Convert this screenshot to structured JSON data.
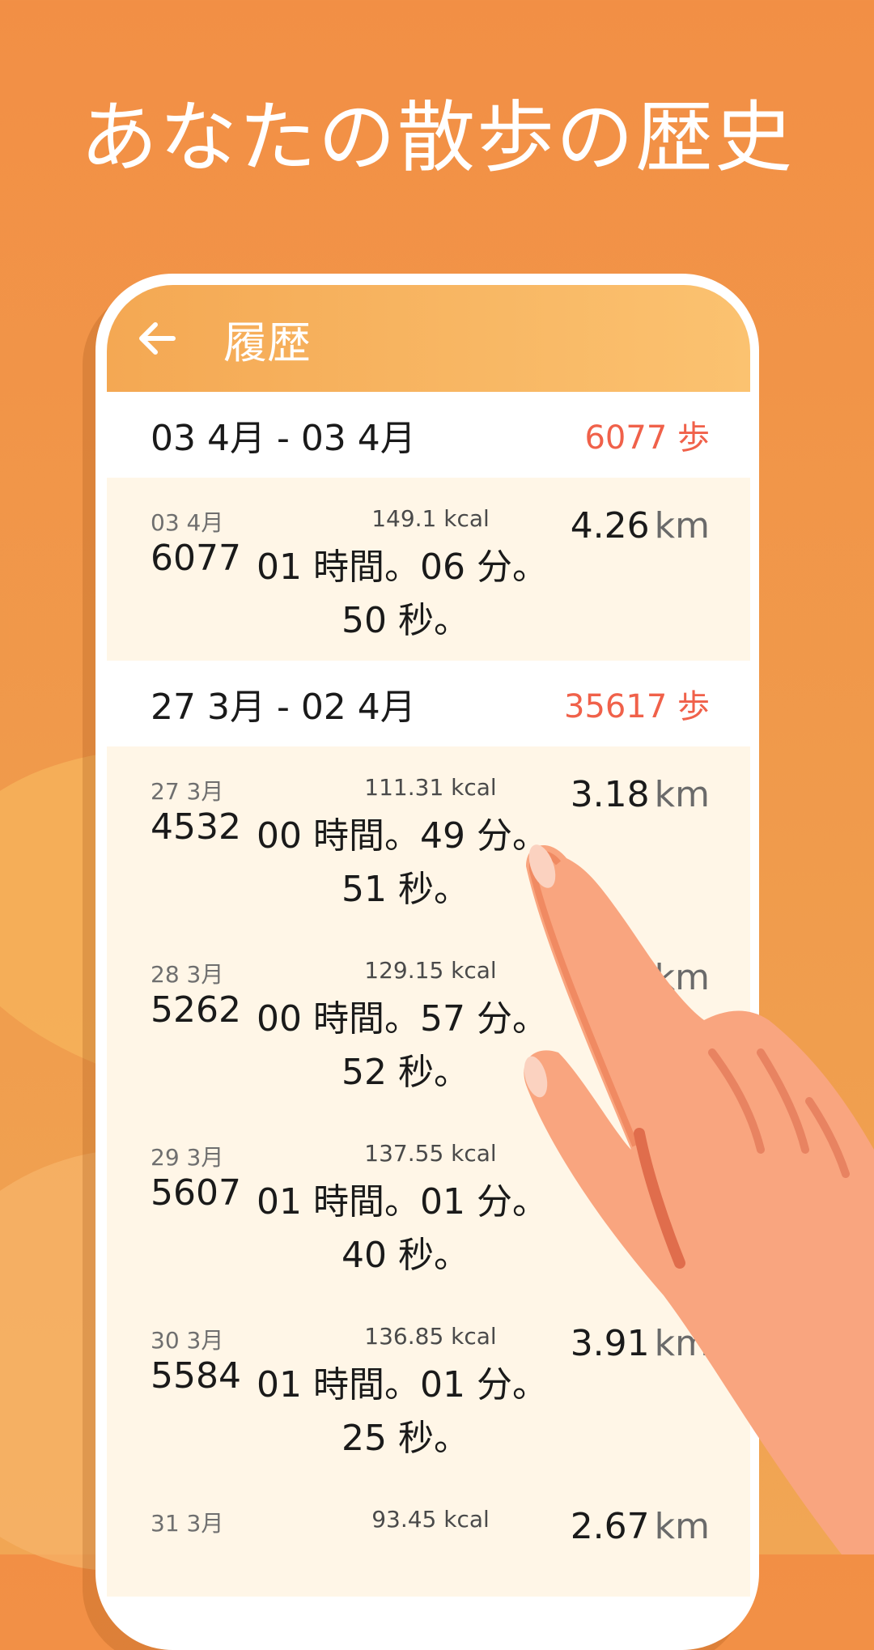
{
  "headline": "あなたの散歩の歴史",
  "appbar": {
    "title": "履歴"
  },
  "weeks": [
    {
      "range": "03 4月 - 03 4月",
      "steps": "6077 歩",
      "days": [
        {
          "date": "03 4月",
          "kcal": "149.1 kcal",
          "steps": "6077",
          "time_hm": "01 時間。06 分。",
          "time_s": "50 秒。",
          "distance": "4.26",
          "unit": "km"
        }
      ]
    },
    {
      "range": "27 3月 - 02 4月",
      "steps": "35617 歩",
      "days": [
        {
          "date": "27 3月",
          "kcal": "111.31 kcal",
          "steps": "4532",
          "time_hm": "00 時間。49 分。",
          "time_s": "51 秒。",
          "distance": "3.18",
          "unit": "km"
        },
        {
          "date": "28 3月",
          "kcal": "129.15 kcal",
          "steps": "5262",
          "time_hm": "00 時間。57 分。",
          "time_s": "52 秒。",
          "distance": "3.",
          "unit": "km"
        },
        {
          "date": "29 3月",
          "kcal": "137.55 kcal",
          "steps": "5607",
          "time_hm": "01 時間。01 分。",
          "time_s": "40 秒。",
          "distance": "",
          "unit": ""
        },
        {
          "date": "30 3月",
          "kcal": "136.85 kcal",
          "steps": "5584",
          "time_hm": "01 時間。01 分。",
          "time_s": "25 秒。",
          "distance": "3.91",
          "unit": "km"
        },
        {
          "date": "31 3月",
          "kcal": "93.45 kcal",
          "steps": "",
          "time_hm": "",
          "time_s": "",
          "distance": "2.67",
          "unit": "km"
        }
      ]
    }
  ],
  "colors": {
    "accent": "#f0614a",
    "appbar_start": "#f4a853",
    "appbar_end": "#fbc270",
    "row_bg": "#fff6e7"
  }
}
